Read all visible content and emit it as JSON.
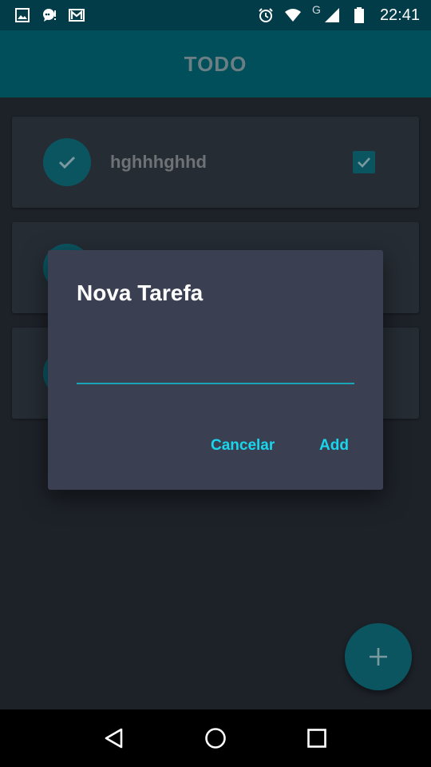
{
  "status_bar": {
    "time": "22:41",
    "network_letter": "G",
    "left_icons": [
      "image-icon",
      "messenger-icon",
      "gmail-icon"
    ],
    "right_icons": [
      "alarm-icon",
      "wifi-icon",
      "signal-icon",
      "battery-icon"
    ]
  },
  "app_bar": {
    "title": "TODO",
    "background": "#004f5b"
  },
  "tasks": [
    {
      "text": "hghhhghhd",
      "done": true
    },
    {
      "text": "",
      "done": false
    },
    {
      "text": "",
      "done": false
    }
  ],
  "dialog": {
    "title": "Nova Tarefa",
    "input_value": "",
    "input_placeholder": "",
    "cancel_label": "Cancelar",
    "add_label": "Add",
    "accent": "#19d6ec"
  },
  "fab": {
    "icon": "plus-icon"
  },
  "nav_bar": {
    "buttons": [
      "back-icon",
      "home-icon",
      "recents-icon"
    ]
  }
}
